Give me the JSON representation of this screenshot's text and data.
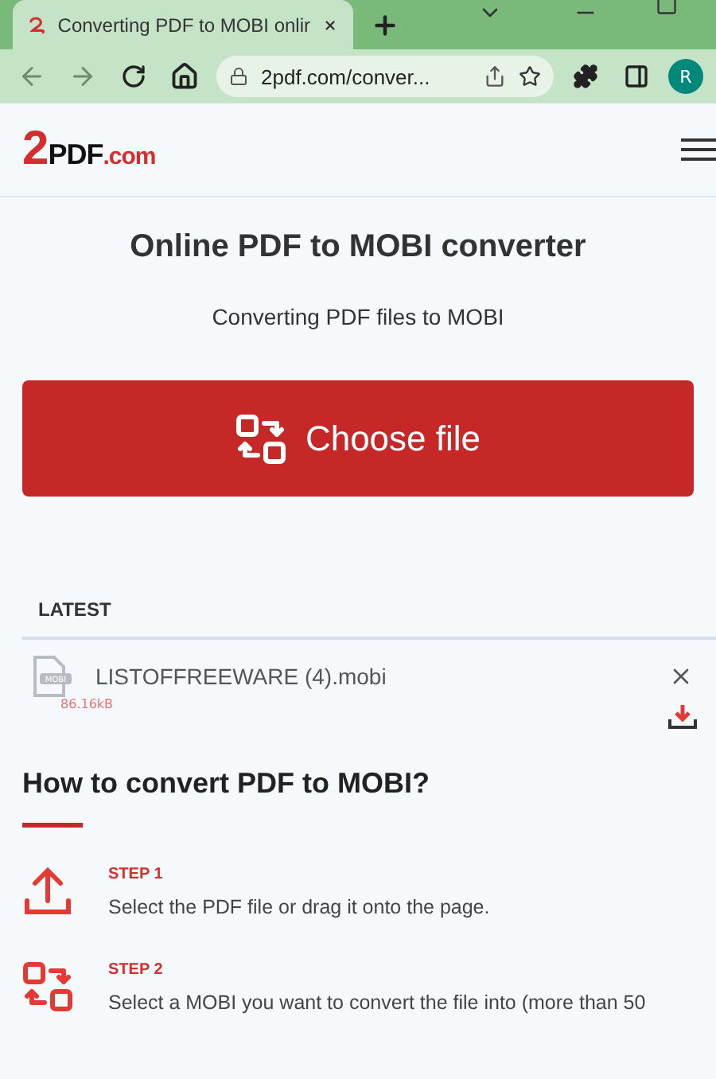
{
  "browser": {
    "tab": {
      "title": "Converting PDF to MOBI onlir",
      "selected": true
    },
    "address": "2pdf.com/conver...",
    "profile": "R"
  },
  "header": {
    "logo": {
      "mark": "2",
      "name": "PDF",
      "domain": ".com"
    }
  },
  "hero": {
    "title": "Online PDF to MOBI converter",
    "subtitle": "Converting PDF files to MOBI",
    "button": "Choose file"
  },
  "latest": {
    "heading": "LATEST",
    "files": [
      {
        "name": "LISTOFFREEWARE (4).mobi",
        "size": "86.16kB",
        "badge": "MOBI"
      }
    ]
  },
  "howto": {
    "heading": "How to convert PDF to MOBI?",
    "steps": [
      {
        "kind": "upload",
        "label": "STEP 1",
        "text": "Select the PDF file or drag it onto the page."
      },
      {
        "kind": "convert",
        "label": "STEP 2",
        "text": "Select a MOBI you want to convert the file into (more than 50"
      }
    ]
  }
}
